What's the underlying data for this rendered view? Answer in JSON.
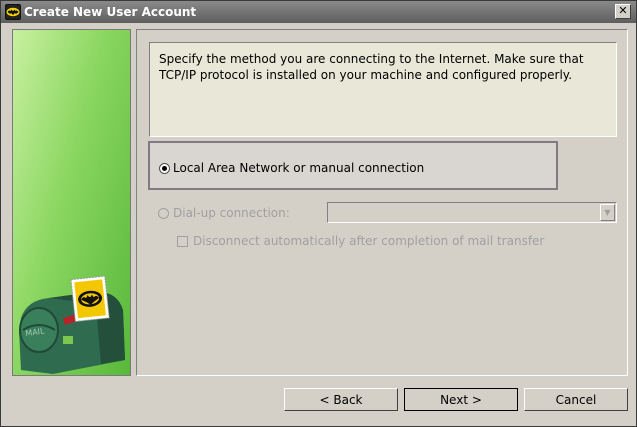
{
  "window": {
    "title": "Create New User Account"
  },
  "info": {
    "text": "Specify the method you are connecting to the Internet. Make sure that TCP/IP protocol is installed on your machine and configured properly."
  },
  "options": {
    "lan_label": "Local Area Network or manual connection",
    "lan_selected": true,
    "dialup_label": "Dial-up connection:",
    "dialup_combo_value": "",
    "disconnect_label": "Disconnect automatically after completion of mail transfer"
  },
  "buttons": {
    "back": "<  Back",
    "next": "Next  >",
    "cancel": "Cancel"
  },
  "sidebar": {
    "image": "mailbox-with-bat-stamp",
    "mailbox_text": "MAIL"
  },
  "icons": {
    "app": "bat-icon",
    "close": "close-icon"
  },
  "colors": {
    "info_bg": "#e9e8d8",
    "sidebar_green": "#8ad660",
    "mailbox": "#2f6b4e",
    "dialog_bg": "#d4d0c8"
  }
}
